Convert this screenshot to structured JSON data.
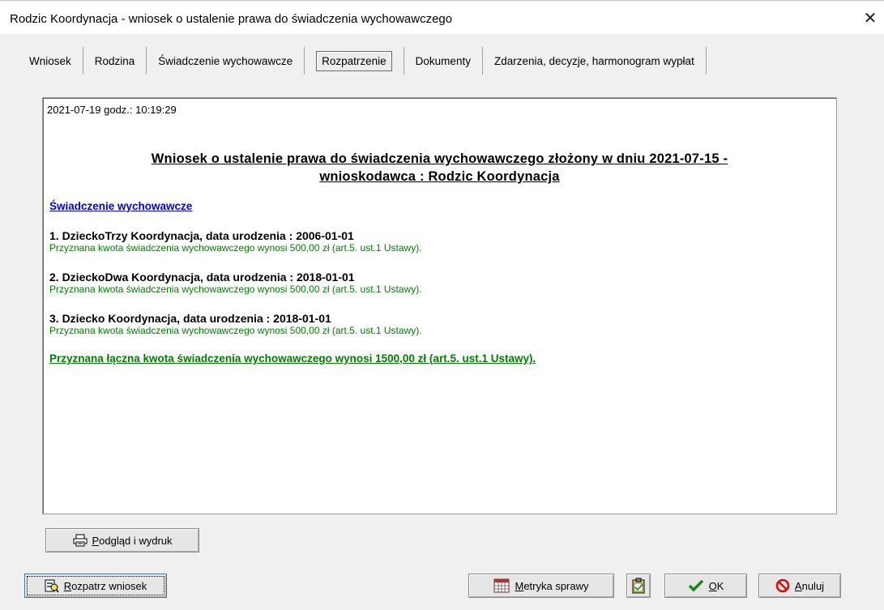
{
  "window": {
    "title": "Rodzic Koordynacja - wniosek o ustalenie prawa do świadczenia wychowawczego",
    "close_glyph": "✕"
  },
  "tabs": [
    {
      "label": "Wniosek"
    },
    {
      "label": "Rodzina"
    },
    {
      "label": "Świadczenie wychowawcze"
    },
    {
      "label": "Rozpatrzenie",
      "active": true
    },
    {
      "label": "Dokumenty"
    },
    {
      "label": "Zdarzenia, decyzje, harmonogram wypłat"
    }
  ],
  "report": {
    "timestamp": "2021-07-19 godz.: 10:19:29",
    "heading_line1": "Wniosek o ustalenie prawa do świadczenia wychowawczego złożony w dniu 2021-07-15 -",
    "heading_line2": "wnioskodawca : Rodzic Koordynacja",
    "section_link": "Świadczenie wychowawcze",
    "children": [
      {
        "name": "1. DzieckoTrzy Koordynacja, data urodzenia : 2006-01-01",
        "note": "Przyznana kwota świadczenia wychowawczego wynosi 500,00 zł (art.5. ust.1 Ustawy)."
      },
      {
        "name": "2. DzieckoDwa Koordynacja, data urodzenia : 2018-01-01",
        "note": "Przyznana kwota świadczenia wychowawczego wynosi 500,00 zł (art.5. ust.1 Ustawy)."
      },
      {
        "name": "3. Dziecko Koordynacja, data urodzenia : 2018-01-01",
        "note": "Przyznana kwota świadczenia wychowawczego wynosi 500,00 zł (art.5. ust.1 Ustawy)."
      }
    ],
    "total": "Przyznana łączna kwota świadczenia wychowawczego wynosi 1500,00 zł (art.5. ust.1 Ustawy)."
  },
  "buttons": {
    "preview": {
      "accel": "P",
      "rest": "odgląd i wydruk",
      "icon": "printer-icon"
    },
    "review": {
      "accel": "R",
      "rest": "ozpatrz wniosek",
      "icon": "document-review-icon"
    },
    "metryka": {
      "accel": "M",
      "rest": "etryka sprawy",
      "icon": "calendar-icon"
    },
    "ok": {
      "accel": "O",
      "rest": "K",
      "icon": "checkmark-icon"
    },
    "cancel": {
      "accel": "A",
      "rest": "nuluj",
      "icon": "cancel-icon"
    }
  },
  "colors": {
    "link": "#0000ee",
    "success": "#008000",
    "window_bg": "#f0f0f0",
    "panel_bg": "#ffffff"
  }
}
